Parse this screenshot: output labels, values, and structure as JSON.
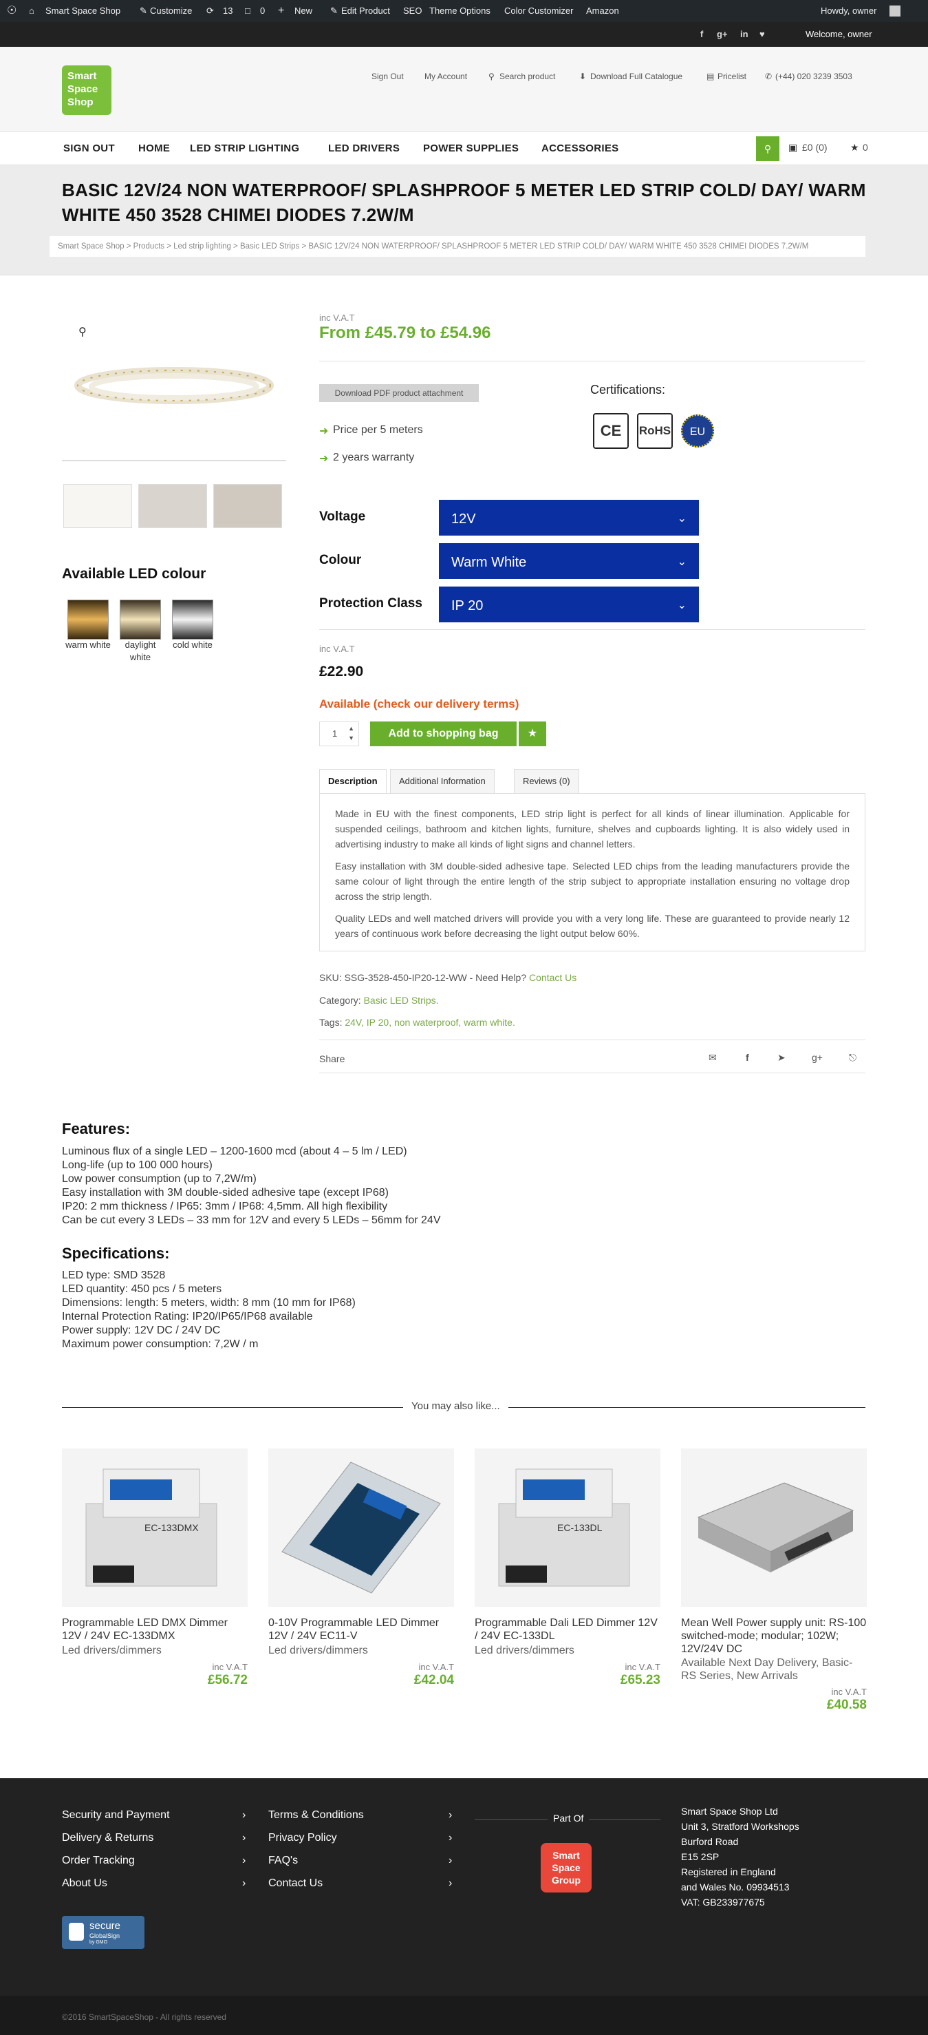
{
  "adminbar": {
    "site": "Smart Space Shop",
    "customize": "Customize",
    "updates": "13",
    "comments": "0",
    "new": "New",
    "edit_product": "Edit Product",
    "seo": "SEO",
    "theme_options": "Theme Options",
    "color_customizer": "Color Customizer",
    "amazon": "Amazon",
    "howdy": "Howdy, owner"
  },
  "topstrip": {
    "welcome": "Welcome, owner"
  },
  "header": {
    "logo": [
      "Smart",
      "Space",
      "Shop"
    ],
    "links": {
      "sign_out": "Sign Out",
      "my_account": "My Account",
      "search_product": "Search product",
      "download_catalogue": "Download Full Catalogue",
      "pricelist": "Pricelist",
      "phone": "(+44) 020 3239 3503"
    }
  },
  "nav": {
    "items": [
      "SIGN OUT",
      "HOME",
      "LED STRIP LIGHTING",
      "LED DRIVERS",
      "POWER SUPPLIES",
      "ACCESSORIES"
    ],
    "cart": "£0 (0)",
    "wishlist": "0"
  },
  "page": {
    "title": "BASIC 12V/24 NON WATERPROOF/ SPLASHPROOF 5 METER LED STRIP COLD/ DAY/ WARM WHITE 450 3528 CHIMEI DIODES 7.2W/M",
    "breadcrumb": "Smart Space Shop > Products > Led strip lighting > Basic LED Strips > BASIC 12V/24 NON WATERPROOF/ SPLASHPROOF 5 METER LED STRIP COLD/ DAY/ WARM WHITE 450 3528 CHIMEI DIODES 7.2W/M"
  },
  "product": {
    "inc_vat": "inc V.A.T",
    "price_range": "From £45.79 to £54.96",
    "download_pdf": "Download PDF product attachment",
    "bullets": [
      "Price per 5 meters",
      "2 years warranty"
    ],
    "certifications_label": "Certifications:",
    "cert_badges": [
      "CE",
      "RoHS",
      "EU"
    ],
    "colour_heading": "Available LED colour",
    "colours": [
      "warm white",
      "daylight white",
      "cold white"
    ],
    "options": [
      {
        "label": "Voltage",
        "value": "12V"
      },
      {
        "label": "Colour",
        "value": "Warm White"
      },
      {
        "label": "Protection Class",
        "value": "IP 20"
      }
    ],
    "inc_vat2": "inc V.A.T",
    "price": "£22.90",
    "availability": "Available (check our delivery terms)",
    "quantity": "1",
    "add_to_bag": "Add to shopping bag",
    "tabs": [
      "Description",
      "Additional Information",
      "Reviews (0)"
    ],
    "description": [
      "Made in EU with the finest components, LED strip light is perfect for all kinds of linear illumination. Applicable for suspended ceilings, bathroom and kitchen lights, furniture, shelves and cupboards lighting.  It is also widely used in advertising industry to make all kinds of light signs and channel letters.",
      "Easy installation with 3M double-sided adhesive tape. Selected LED chips from the leading manufacturers provide the same colour of light through the entire length of the strip subject to appropriate installation ensuring no voltage drop across the strip length.",
      "Quality LEDs and well matched drivers will provide you with a very long life. These are guaranteed to provide nearly 12 years of continuous work before decreasing the light output below 60%."
    ],
    "sku_text": "SKU: SSG-3528-450-IP20-12-WW - Need Help?",
    "contact_us": "Contact Us",
    "category_label": "Category:",
    "category": "Basic LED Strips.",
    "tags_label": "Tags:",
    "tags": "24V, IP 20, non waterproof, warm white.",
    "share": "Share"
  },
  "features": {
    "heading": "Features:",
    "lines": [
      "Luminous flux of a single LED – 1200-1600 mcd (about  4 – 5 lm / LED)",
      "Long-life (up to 100 000 hours)",
      "Low power consumption (up to 7,2W/m)",
      "Easy installation with 3M double-sided adhesive tape (except IP68)",
      "IP20: 2 mm thickness / IP65: 3mm / IP68: 4,5mm. All high flexibility",
      "Can be cut every 3 LEDs – 33 mm for 12V and every 5 LEDs – 56mm for 24V"
    ]
  },
  "specs": {
    "heading": "Specifications:",
    "lines": [
      "LED type:  SMD 3528",
      "LED quantity: 450 pcs / 5 meters",
      "Dimensions:  length: 5 meters, width: 8 mm (10 mm for IP68)",
      "Internal Protection Rating: IP20/IP65/IP68 available",
      "Power supply:  12V DC / 24V DC",
      "Maximum power consumption: 7,2W / m"
    ]
  },
  "related": {
    "heading": "You may also like...",
    "items": [
      {
        "name": "Programmable LED DMX Dimmer 12V / 24V EC-133DMX",
        "category": "Led drivers/dimmers",
        "inc_vat": "inc V.A.T",
        "price": "£56.72",
        "device_label": "EC-133DMX"
      },
      {
        "name": "0-10V Programmable LED Dimmer 12V / 24V EC11-V",
        "category": "Led drivers/dimmers",
        "inc_vat": "inc V.A.T",
        "price": "£42.04",
        "device_label": ""
      },
      {
        "name": "Programmable Dali LED Dimmer 12V / 24V EC-133DL",
        "category": "Led drivers/dimmers",
        "inc_vat": "inc V.A.T",
        "price": "£65.23",
        "device_label": "EC-133DL"
      },
      {
        "name": "Mean Well Power supply unit: RS-100 switched-mode; modular; 102W; 12V/24V DC",
        "category": "Available Next Day Delivery, Basic- RS Series, New Arrivals",
        "inc_vat": "inc V.A.T",
        "price": "£40.58",
        "device_label": ""
      }
    ]
  },
  "footer": {
    "col1": [
      "Security and Payment",
      "Delivery & Returns",
      "Order Tracking",
      "About Us"
    ],
    "col2": [
      "Terms & Conditions",
      "Privacy Policy",
      "FAQ's",
      "Contact Us"
    ],
    "part_of": "Part Of",
    "group_logo": [
      "Smart",
      "Space",
      "Group"
    ],
    "address": [
      "Smart Space Shop Ltd",
      "Unit 3, Stratford Workshops",
      "Burford Road",
      "E15 2SP",
      "Registered in England",
      "and Wales No. 09934513",
      "VAT: GB233977675"
    ],
    "secure_badge": [
      "secure",
      "GlobalSign",
      "by GMO"
    ],
    "copyright": "©2016 SmartSpaceShop - All rights reserved"
  }
}
